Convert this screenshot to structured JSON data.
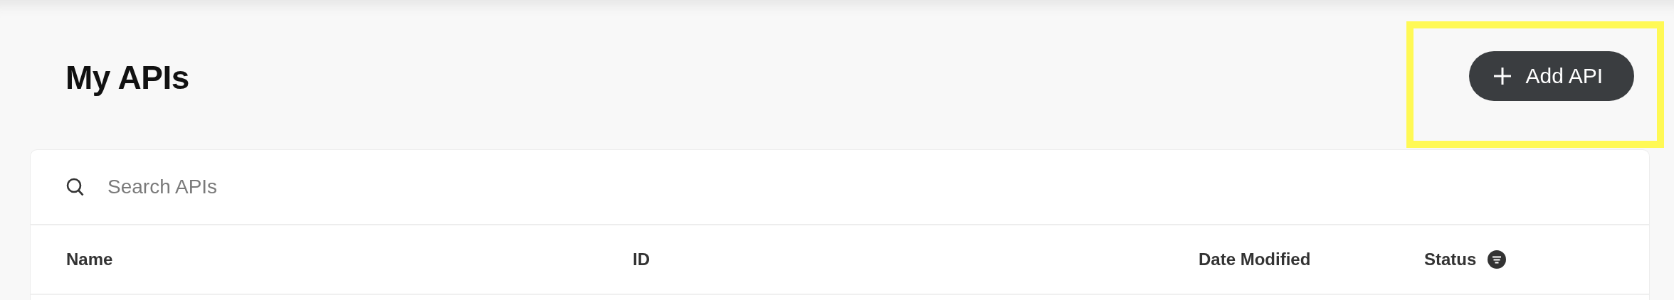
{
  "page": {
    "title": "My APIs"
  },
  "add_button": {
    "label": "Add API",
    "highlighted": true
  },
  "search": {
    "placeholder": "Search APIs"
  },
  "table": {
    "columns": [
      {
        "label": "Name",
        "filter": false
      },
      {
        "label": "ID",
        "filter": false
      },
      {
        "label": "Date Modified",
        "filter": false
      },
      {
        "label": "Status",
        "filter": true
      }
    ]
  }
}
